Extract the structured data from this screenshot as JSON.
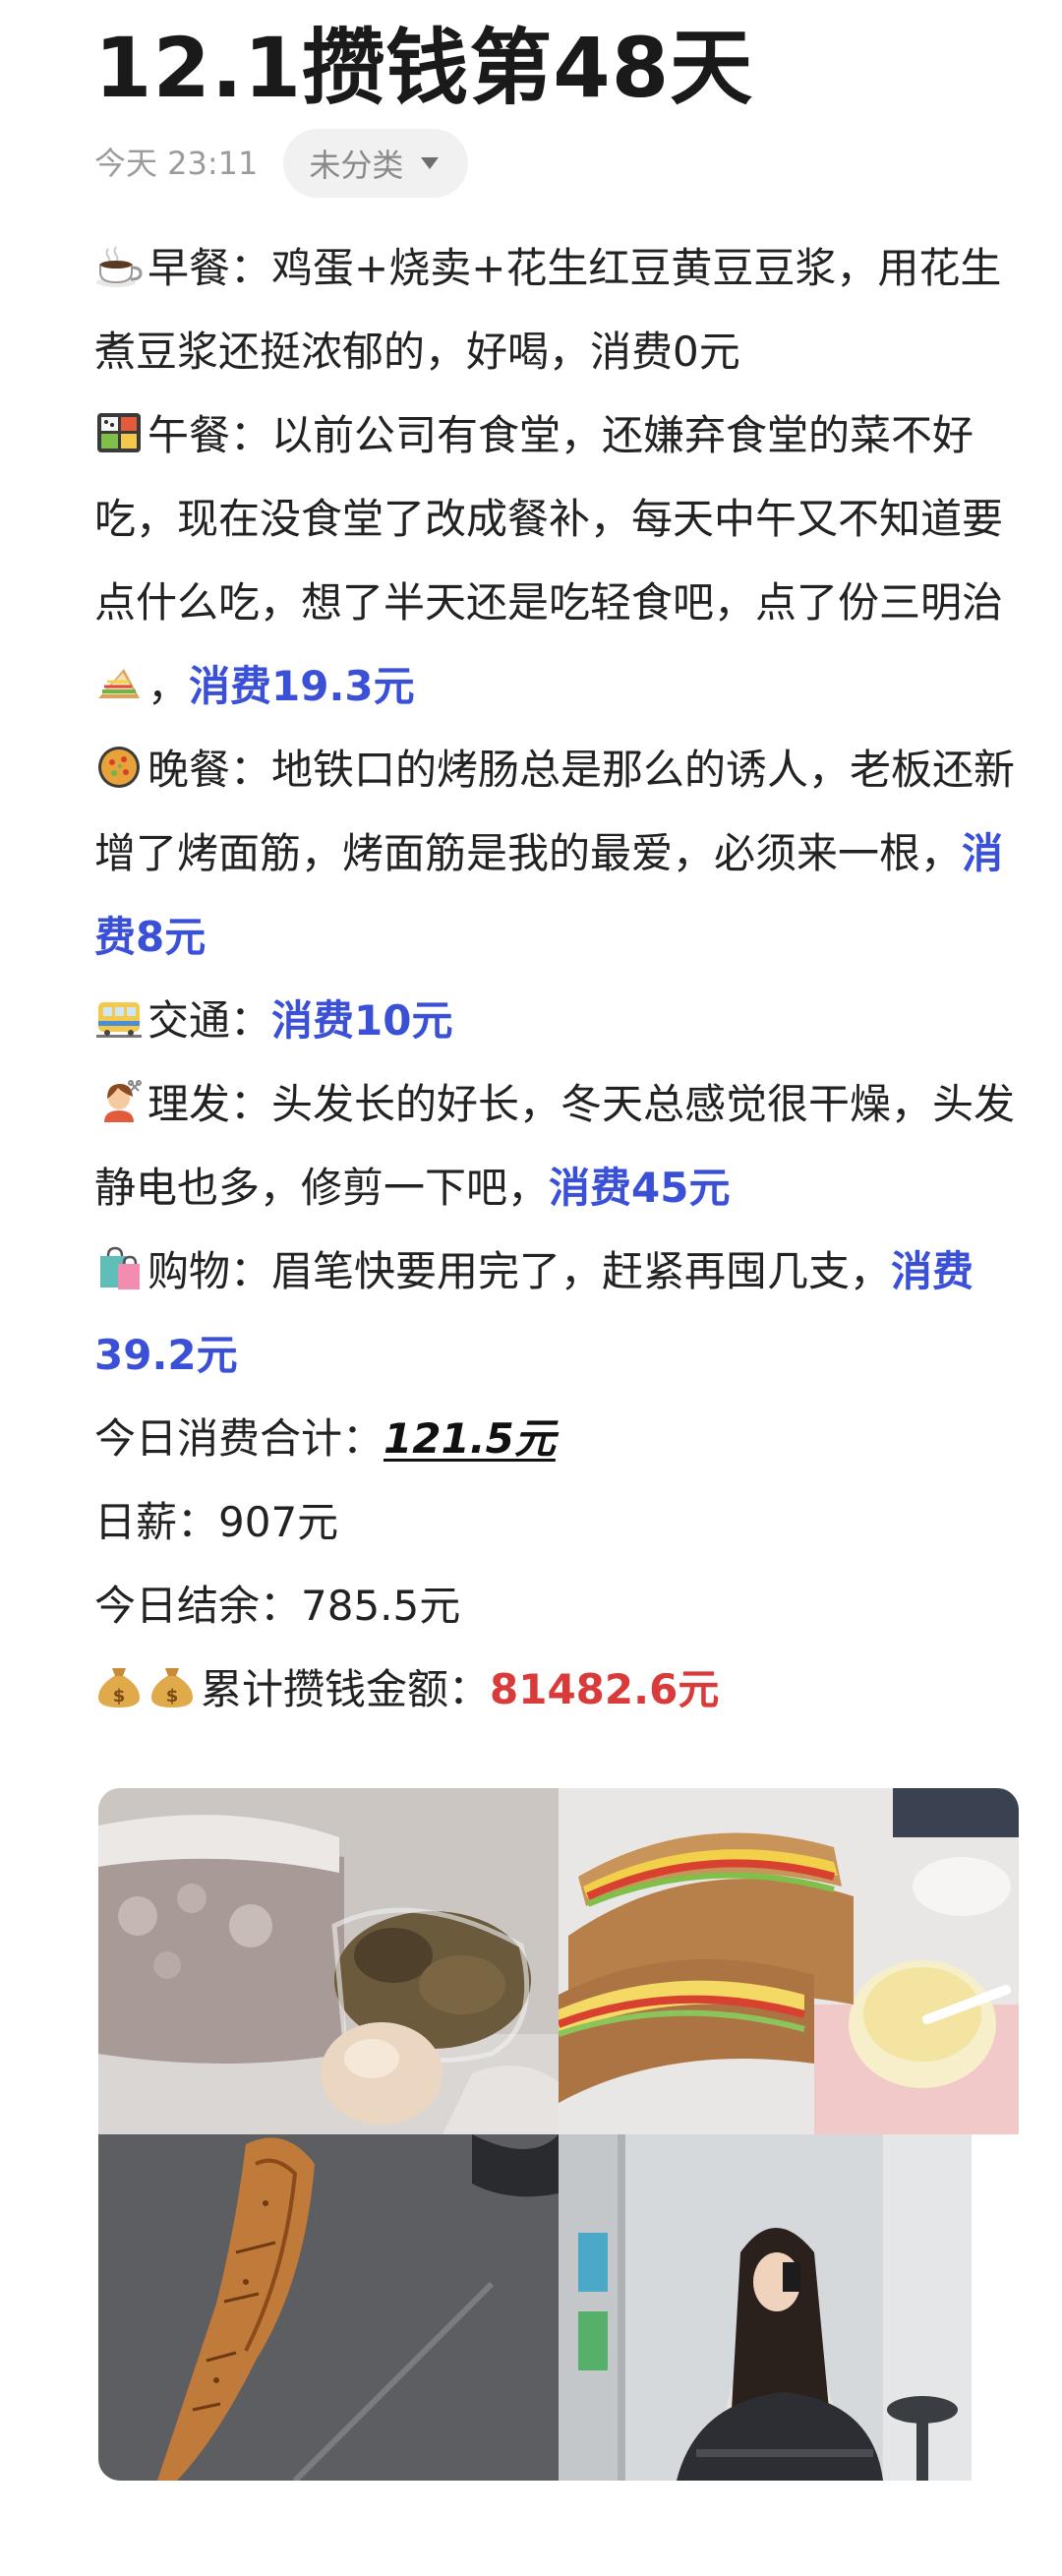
{
  "post": {
    "title": "12.1攒钱第48天",
    "time": "今天 23:11",
    "category": "未分类"
  },
  "entries": {
    "breakfast": {
      "label": "早餐：",
      "text": "鸡蛋+烧卖+花生红豆黄豆豆浆，用花生煮豆浆还挺浓郁的，好喝，消费0元"
    },
    "lunch": {
      "label": "午餐：",
      "text": "以前公司有食堂，还嫌弃食堂的菜不好吃，现在没食堂了改成餐补，每天中午又不知道要点什么吃，想了半天还是吃轻食吧，点了份三明治",
      "sep": "，",
      "cost": "消费19.3元"
    },
    "dinner": {
      "label": "晚餐：",
      "text": "地铁口的烤肠总是那么的诱人，老板还新增了烤面筋，烤面筋是我的最爱，必须来一根，",
      "cost": "消费8元"
    },
    "transport": {
      "label": "交通：",
      "cost": "消费10元"
    },
    "haircut": {
      "label": "理发：",
      "text": "头发长的好长，冬天总感觉很干燥，头发静电也多，修剪一下吧，",
      "cost": "消费45元"
    },
    "shopping": {
      "label": "购物：",
      "text": "眉笔快要用完了，赶紧再囤几支，",
      "cost": "消费39.2元"
    }
  },
  "summary": {
    "total_label": "今日消费合计：",
    "total_value": "121.5元",
    "salary_label": "日薪：",
    "salary_value": "907元",
    "balance_label": "今日结余：",
    "balance_value": "785.5元",
    "savings_label": "累计攒钱金额：",
    "savings_value": "81482.6元"
  },
  "icons": {
    "breakfast": "coffee-cup-icon",
    "lunch": "bento-box-icon",
    "sandwich": "sandwich-icon",
    "dinner": "paella-pan-icon",
    "transport": "tram-icon",
    "haircut": "haircut-icon",
    "shopping": "shopping-bags-icon",
    "money": "money-bag-icon"
  },
  "colors": {
    "accent_blue": "#3a50d6",
    "accent_red": "#d93a3a",
    "meta_gray": "#9b9b9b"
  },
  "photos": [
    "breakfast-photo",
    "sandwich-photo",
    "gluten-skewer-photo",
    "haircut-selfie-photo"
  ]
}
